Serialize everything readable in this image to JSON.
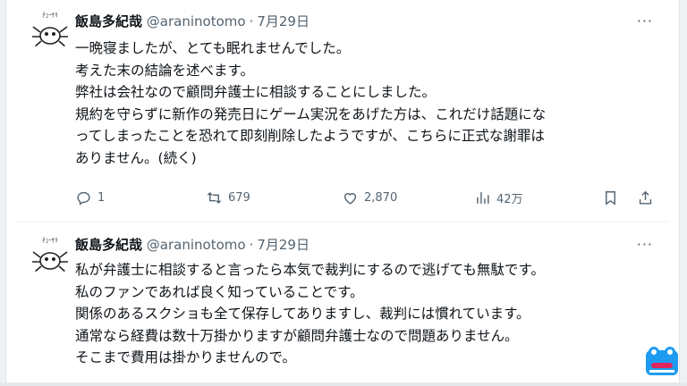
{
  "tweets": [
    {
      "author": {
        "name": "飯島多紀哉",
        "handle": "@araninotomo",
        "date": "7月29日",
        "avatar": "spider-cartoon-avatar"
      },
      "lines": [
        "一晩寝ましたが、とても眠れませんでした。",
        "考えた末の結論を述べます。",
        "弊社は会社なので顧問弁護士に相談することにしました。",
        "規約を守らずに新作の発売日にゲーム実況をあげた方は、これだけ話題にな",
        "ってしまったことを恐れて即刻削除したようですが、こちらに正式な謝罪は",
        "ありません。(続く)"
      ],
      "actions": {
        "replies": "1",
        "retweets": "679",
        "likes": "2,870",
        "views": "42万"
      }
    },
    {
      "author": {
        "name": "飯島多紀哉",
        "handle": "@araninotomo",
        "date": "7月29日",
        "avatar": "spider-cartoon-avatar"
      },
      "lines": [
        "私が弁護士に相談すると言ったら本気で裁判にするので逃げても無駄です。",
        "私のファンであれば良く知っていることです。",
        "関係のあるスクショも全て保存してありますし、裁判には慣れています。",
        "通常なら経費は数十万掛かりますが顧問弁護士なので問題ありません。",
        "そこまで費用は掛かりませんので。"
      ]
    }
  ],
  "icons": {
    "reply": "reply-icon",
    "retweet": "retweet-icon",
    "like": "heart-icon",
    "views": "views-icon",
    "bookmark": "bookmark-icon",
    "share": "share-icon",
    "more": "more-icon",
    "corner_logo": "frog-logo-icon"
  },
  "colors": {
    "text": "#0f1419",
    "secondary": "#536471",
    "divider": "#eff3f4"
  }
}
